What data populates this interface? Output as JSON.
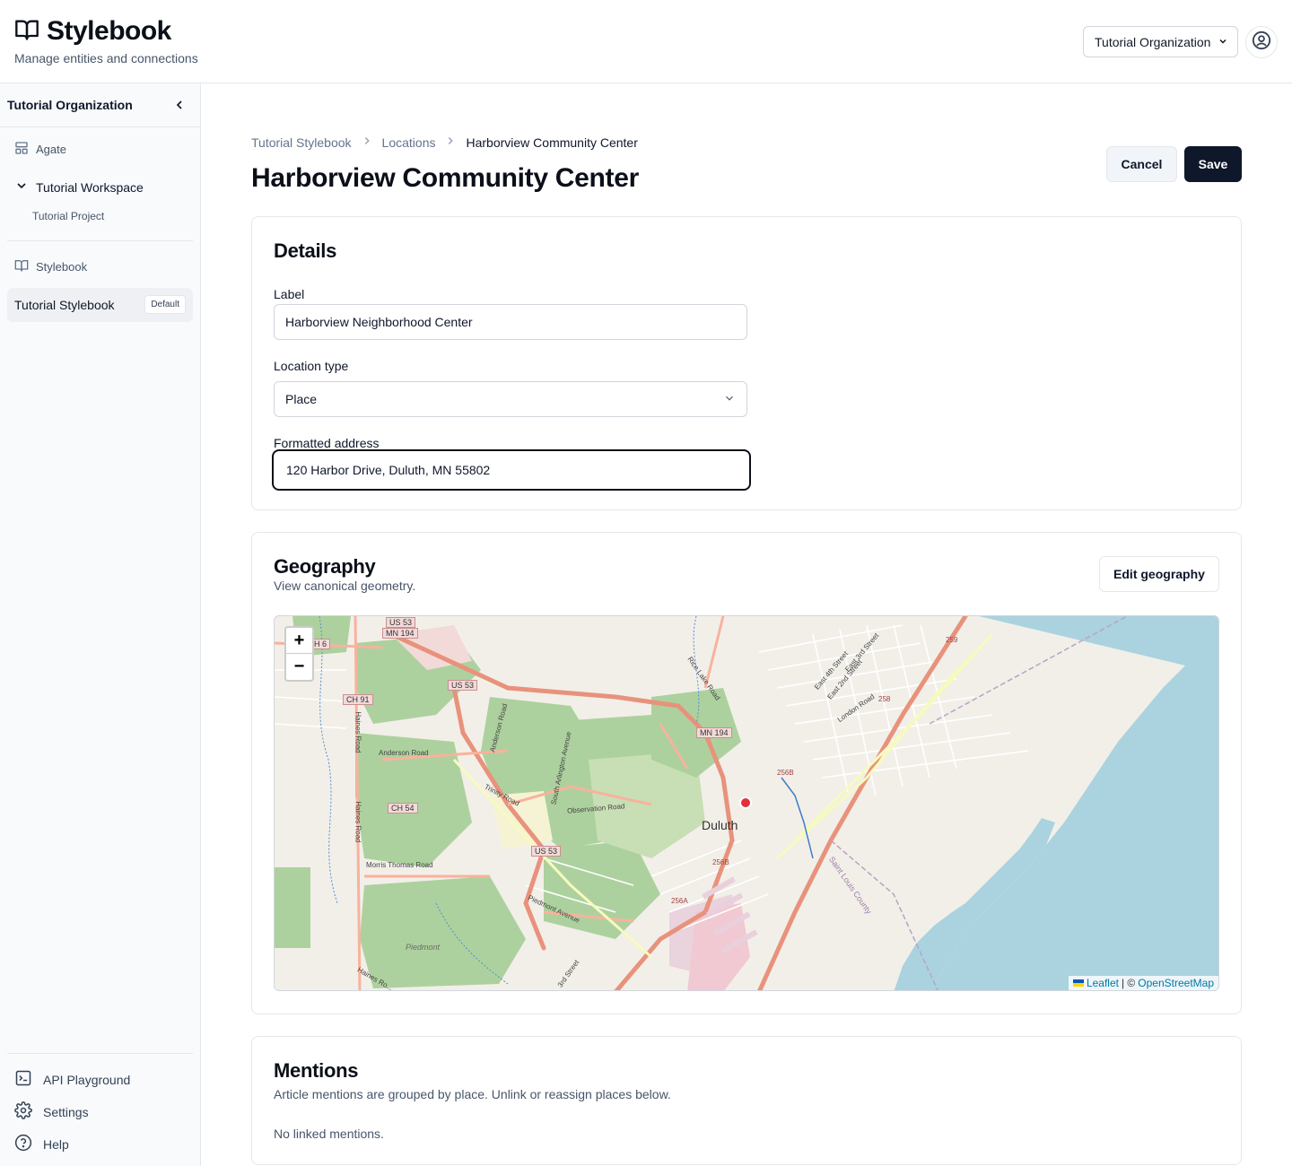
{
  "header": {
    "brand_title": "Stylebook",
    "brand_subtitle": "Manage entities and connections",
    "org_select_value": "Tutorial Organization"
  },
  "sidebar": {
    "org_name": "Tutorial Organization",
    "agate_label": "Agate",
    "workspace_label": "Tutorial Workspace",
    "project_label": "Tutorial Project",
    "stylebook_section_label": "Stylebook",
    "active_item_label": "Tutorial Stylebook",
    "active_item_badge": "Default",
    "footer": {
      "api_label": "API Playground",
      "settings_label": "Settings",
      "help_label": "Help"
    }
  },
  "breadcrumb": {
    "items": [
      "Tutorial Stylebook",
      "Locations",
      "Harborview Community Center"
    ]
  },
  "page": {
    "title": "Harborview Community Center",
    "cancel_label": "Cancel",
    "save_label": "Save"
  },
  "details": {
    "title": "Details",
    "label_label": "Label",
    "label_value": "Harborview Neighborhood Center",
    "type_label": "Location type",
    "type_value": "Place",
    "address_label": "Formatted address",
    "address_value": "120 Harbor Drive, Duluth, MN 55802"
  },
  "geography": {
    "title": "Geography",
    "subtitle": "View canonical geometry.",
    "edit_label": "Edit geography",
    "map": {
      "zoom_in": "+",
      "zoom_out": "−",
      "attribution_leaflet": "Leaflet",
      "attribution_sep": "| ©",
      "attribution_osm": "OpenStreetMap",
      "city_label": "Duluth",
      "road_labels": {
        "us53_top": "US 53",
        "mn194_top": "MN 194",
        "ch6": "H 6",
        "us53_mid": "US 53",
        "ch91": "CH 91",
        "mn194_mid": "MN 194",
        "anderson_road": "Anderson Road",
        "anderson_road_v": "Anderson Road",
        "haines_road": "Haines Road",
        "haines_road_2": "Haines Road",
        "haines_road_3": "Haines Ro...",
        "trinity_road": "Trinity Road",
        "south_arlington": "South Arlington Avenue",
        "observation_road": "Observation Road",
        "ch54": "CH 54",
        "us53_low": "US 53",
        "morris_thomas": "Morris Thomas Road",
        "piedmont_avenue": "Piedmont Avenue",
        "piedmont": "Piedmont",
        "third_street": "3rd Street",
        "rice_lake": "Rice Lake Road",
        "london_road": "London Road",
        "e4th": "East 4th Street",
        "e3rd": "East 3rd Street",
        "e2nd": "East 2nd Street",
        "st_louis_county": "Saint Louis County",
        "x259": "259",
        "x258": "258",
        "x256b": "256B",
        "x256b2": "256B",
        "x256a": "256A"
      }
    }
  },
  "mentions": {
    "title": "Mentions",
    "subtitle": "Article mentions are grouped by place. Unlink or reassign places below.",
    "empty": "No linked mentions."
  },
  "colors": {
    "primary": "#0f172a",
    "water": "#aad3df",
    "forest": "#add19e",
    "marker": "#e0303a"
  }
}
